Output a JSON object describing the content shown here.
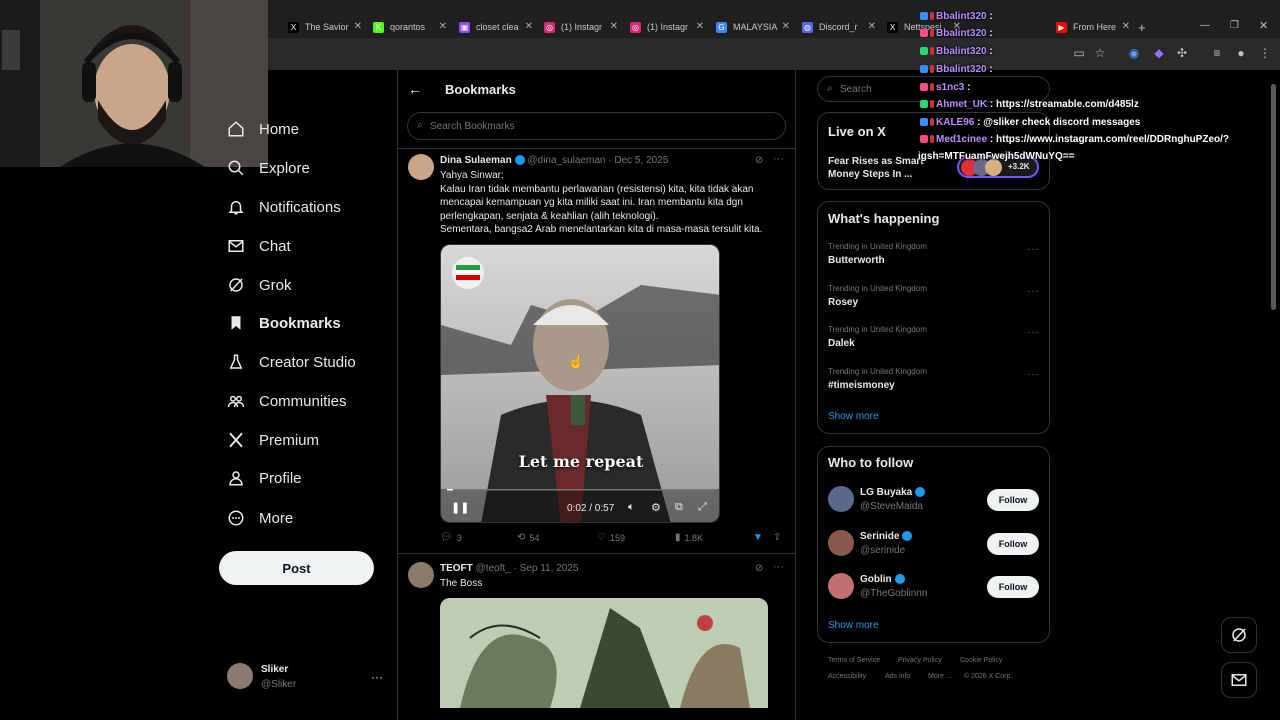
{
  "browser": {
    "tabs": [
      {
        "label": "The Savior",
        "color": "#000000",
        "glyph": "X"
      },
      {
        "label": "qorantos",
        "color": "#53fc18",
        "glyph": "K"
      },
      {
        "label": "closet clea",
        "color": "#9146ff",
        "glyph": "▣"
      },
      {
        "label": "(1) Instagr",
        "color": "#d62976",
        "glyph": "◎"
      },
      {
        "label": "(1) Instagr",
        "color": "#d62976",
        "glyph": "◎"
      },
      {
        "label": "MALAYSIA",
        "color": "#4285f4",
        "glyph": "G"
      },
      {
        "label": "Discord_r",
        "color": "#5865f2",
        "glyph": "◍"
      },
      {
        "label": "Nettspesi",
        "color": "#000000",
        "glyph": "X"
      },
      {
        "label": "From Here",
        "color": "#ff0000",
        "glyph": "▶"
      }
    ]
  },
  "nav": {
    "home": "Home",
    "explore": "Explore",
    "notifications": "Notifications",
    "chat": "Chat",
    "grok": "Grok",
    "bookmarks": "Bookmarks",
    "creator_studio": "Creator Studio",
    "communities": "Communities",
    "premium": "Premium",
    "profile": "Profile",
    "more": "More",
    "post": "Post"
  },
  "account": {
    "name": "Sliker",
    "handle": "@Sliker"
  },
  "header": {
    "title": "Bookmarks",
    "search_placeholder": "Search Bookmarks"
  },
  "tweets": [
    {
      "name": "Dina Sulaeman",
      "handle": "@dina_sulaeman",
      "date": "· Dec 5, 2025",
      "lines": [
        "Yahya Sinwar:",
        "Kalau Iran tidak membantu perlawanan (resistensi) kita, kita tidak akan",
        "mencapai kemampuan yg kita miliki saat ini. Iran membantu kita dgn",
        "perlengkapan, senjata & keahlian (alih teknologi).",
        "Sementara, bangsa2 Arab menelantarkan kita di masa-masa tersulit kita."
      ],
      "video_caption": "Let me repeat",
      "video_time": "0:02 / 0:57",
      "replies": "3",
      "reposts": "54",
      "likes": "159",
      "views": "1.8K"
    },
    {
      "name": "TEOFT",
      "handle": "@teoft_",
      "date": "· Sep 11, 2025",
      "text": "The Boss"
    }
  ],
  "right": {
    "search_placeholder": "Search",
    "live_title": "Live on X",
    "live_text_1": "Fear Rises as Smart",
    "live_text_2": "Money Steps In ...",
    "live_count": "+3.2K",
    "happening_title": "What's happening",
    "trends": [
      {
        "context": "Trending in United Kingdom",
        "name": "Butterworth"
      },
      {
        "context": "Trending in United Kingdom",
        "name": "Rosey"
      },
      {
        "context": "Trending in United Kingdom",
        "name": "Dalek"
      },
      {
        "context": "Trending in United Kingdom",
        "name": "#timeismoney"
      }
    ],
    "show_more": "Show more",
    "wtf_title": "Who to follow",
    "follow_label": "Follow",
    "who_to_follow": [
      {
        "name": "LG Buyaka",
        "handle": "@SteveMaida"
      },
      {
        "name": "Serinide",
        "handle": "@serinide"
      },
      {
        "name": "Goblin",
        "handle": "@TheGoblinnn"
      }
    ],
    "footer": [
      "Terms of Service",
      "Privacy Policy",
      "Cookie Policy",
      "Accessibility",
      "Ads info",
      "More ...",
      "© 2026 X Corp."
    ]
  },
  "chat": [
    {
      "user": "Bbalint320",
      "msg": ""
    },
    {
      "user": "Bbalint320",
      "msg": ""
    },
    {
      "user": "Bbalint320",
      "msg": ""
    },
    {
      "user": "Bbalint320",
      "msg": ""
    },
    {
      "user": "s1nc3",
      "msg": ""
    },
    {
      "user": "Ahmet_UK",
      "msg": "https://streamable.com/d485lz"
    },
    {
      "user": "KALE96",
      "msg": "@sliker check discord messages"
    },
    {
      "user": "Med1cinee",
      "msg": "https://www.instagram.com/reel/DDRnghuPZeo/?"
    },
    {
      "user": "",
      "msg": "igsh=MTFuamFwejh5dWNuYQ=="
    }
  ],
  "colors": {
    "accent": "#1d9bf0",
    "background": "#000000",
    "border": "#2f3336",
    "muted": "#71767b"
  }
}
